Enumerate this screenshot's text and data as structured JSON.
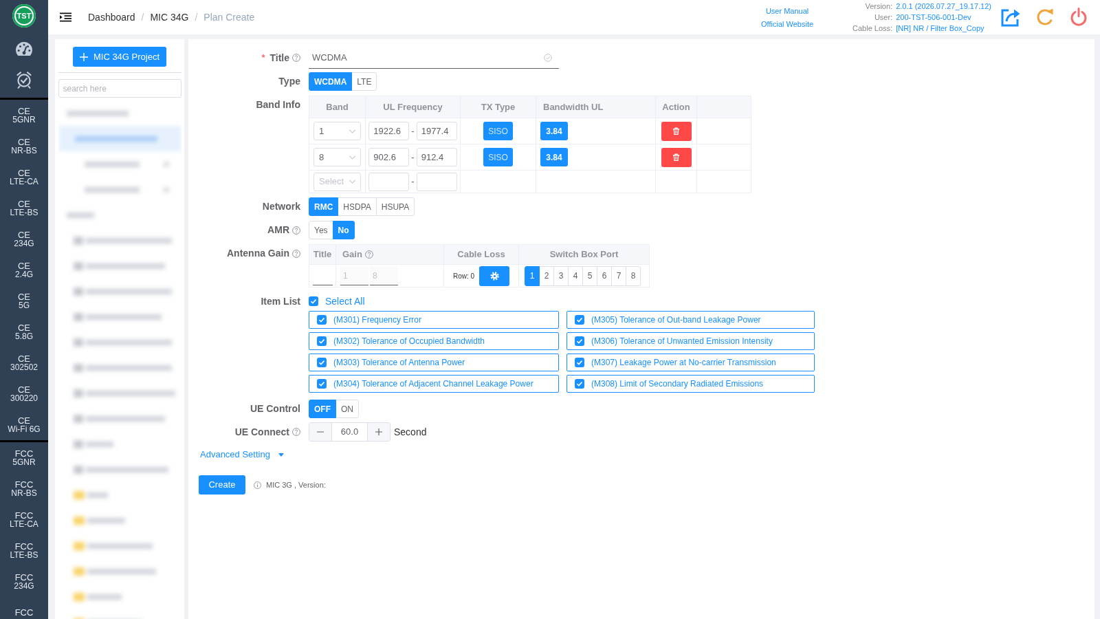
{
  "sidebar": {
    "logo": "TST",
    "groups": [
      {
        "items": [
          {
            "label": "CE",
            "sub": "5GNR"
          },
          {
            "label": "CE",
            "sub": "NR-BS"
          },
          {
            "label": "CE",
            "sub": "LTE-CA"
          },
          {
            "label": "CE",
            "sub": "LTE-BS"
          },
          {
            "label": "CE",
            "sub": "234G"
          },
          {
            "label": "CE",
            "sub": "2.4G"
          },
          {
            "label": "CE",
            "sub": "5G"
          },
          {
            "label": "CE",
            "sub": "5.8G"
          },
          {
            "label": "CE",
            "sub": "302502"
          },
          {
            "label": "CE",
            "sub": "300220"
          },
          {
            "label": "CE",
            "sub": "Wi-Fi 6G"
          }
        ]
      },
      {
        "items": [
          {
            "label": "FCC",
            "sub": "5GNR"
          },
          {
            "label": "FCC",
            "sub": "NR-BS"
          },
          {
            "label": "FCC",
            "sub": "LTE-CA"
          },
          {
            "label": "FCC",
            "sub": "LTE-BS"
          },
          {
            "label": "FCC",
            "sub": "234G"
          },
          {
            "label": "FCC"
          }
        ]
      }
    ]
  },
  "header": {
    "breadcrumb": [
      {
        "label": "Dashboard",
        "current": false,
        "separator": "/"
      },
      {
        "label": "MIC 34G",
        "current": false,
        "separator": "/"
      },
      {
        "label": "Plan Create",
        "current": true
      }
    ],
    "links": [
      "User Manual",
      "Official Website"
    ],
    "info": [
      {
        "label": "Version:",
        "value": "2.0.1 (2026.07.27_19.17.12)"
      },
      {
        "label": "User:",
        "value": "200-TST-506-001-Dev"
      },
      {
        "label": "Cable Loss:",
        "value": "[NR] NR / Filter Box_Copy"
      }
    ]
  },
  "project_panel": {
    "new_button": "MIC 34G Project",
    "search": {
      "placeholder": "search here"
    }
  },
  "form": {
    "title": {
      "label": "Title",
      "required_mark": "*",
      "help": true,
      "value": "WCDMA"
    },
    "type": {
      "label": "Type",
      "options": [
        {
          "label": "WCDMA",
          "selected": true
        },
        {
          "label": "LTE",
          "selected": false
        }
      ]
    },
    "band_info": {
      "label": "Band Info",
      "columns": [
        "Band",
        "UL Frequency",
        "TX Type",
        "Bandwidth UL",
        "Action"
      ],
      "rows": [
        {
          "band": "1",
          "ul_from": "1922.6",
          "separator": "-",
          "ul_to": "1977.4",
          "tx_type": "SISO",
          "bandwidth": "3.84"
        },
        {
          "band": "8",
          "ul_from": "902.6",
          "separator": "-",
          "ul_to": "912.4",
          "tx_type": "SISO",
          "bandwidth": "3.84"
        }
      ],
      "new_row": {
        "band_placeholder": "Select",
        "separator": "-"
      }
    },
    "network": {
      "label": "Network",
      "options": [
        {
          "label": "RMC",
          "selected": true
        },
        {
          "label": "HSDPA",
          "selected": false
        },
        {
          "label": "HSUPA",
          "selected": false
        }
      ]
    },
    "amr": {
      "label": "AMR",
      "help": true,
      "options": [
        {
          "label": "Yes",
          "selected": false
        },
        {
          "label": "No",
          "selected": true
        }
      ]
    },
    "antenna_gain": {
      "label": "Antenna Gain",
      "help": true,
      "columns": [
        {
          "label": "Title",
          "help": false
        },
        {
          "label": "Gain",
          "help": true
        },
        {
          "label": "Cable Loss",
          "help": false
        },
        {
          "label": "Switch Box Port",
          "help": false
        }
      ],
      "row": {
        "gain_placeholders": [
          "1",
          "8"
        ],
        "row_label": "Row: 0",
        "ports": [
          {
            "label": "1",
            "selected": true
          },
          {
            "label": "2",
            "selected": false
          },
          {
            "label": "3",
            "selected": false
          },
          {
            "label": "4",
            "selected": false
          },
          {
            "label": "5",
            "selected": false
          },
          {
            "label": "6",
            "selected": false
          },
          {
            "label": "7",
            "selected": false
          },
          {
            "label": "8",
            "selected": false
          }
        ]
      }
    },
    "item_list": {
      "label": "Item List",
      "select_all": {
        "label": "Select All",
        "checked": true
      },
      "items": [
        {
          "label": "(M301) Frequency Error",
          "checked": true
        },
        {
          "label": "(M302) Tolerance of Occupied Bandwidth",
          "checked": true
        },
        {
          "label": "(M303) Tolerance of Antenna Power",
          "checked": true
        },
        {
          "label": "(M304) Tolerance of Adjacent Channel Leakage Power",
          "checked": true
        },
        {
          "label": "(M305) Tolerance of Out-band Leakage Power",
          "checked": true
        },
        {
          "label": "(M306) Tolerance of Unwanted Emission Intensity",
          "checked": true
        },
        {
          "label": "(M307) Leakage Power at No-carrier Transmission",
          "checked": true
        },
        {
          "label": "(M308) Limit of Secondary Radiated Emissions",
          "checked": true
        }
      ]
    },
    "ue_control": {
      "label": "UE Control",
      "options": [
        {
          "label": "OFF",
          "selected": true
        },
        {
          "label": "ON",
          "selected": false
        }
      ]
    },
    "ue_connect": {
      "label": "UE Connect",
      "help": true,
      "value": "60.0",
      "unit": "Second"
    },
    "advanced_setting": {
      "label": "Advanced Setting",
      "expanded": false
    },
    "actions": {
      "create": "Create",
      "note": "MIC 3G , Version:"
    }
  }
}
